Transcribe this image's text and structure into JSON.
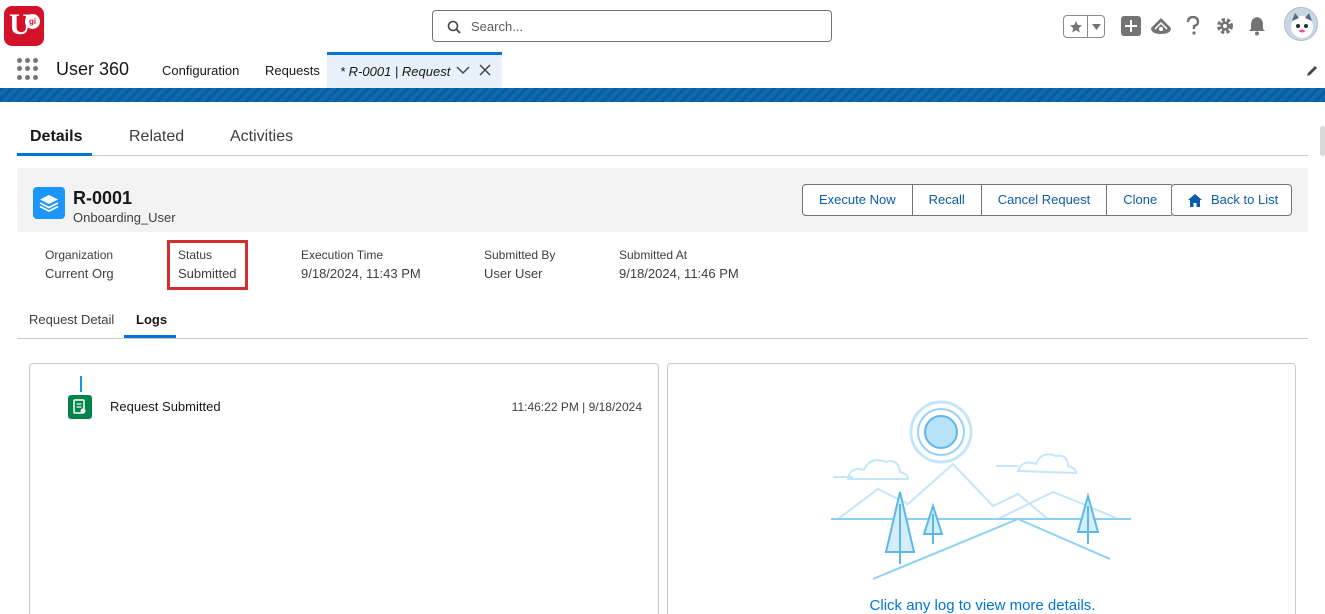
{
  "header": {
    "logo_text": "U",
    "logo_badge": "gi",
    "search_placeholder": "Search..."
  },
  "nav": {
    "app_name": "User 360",
    "items": [
      "Configuration",
      "Requests"
    ],
    "active_tab": "* R-0001 | Request"
  },
  "tabs": [
    "Details",
    "Related",
    "Activities"
  ],
  "record": {
    "id": "R-0001",
    "subtitle": "Onboarding_User",
    "actions": [
      "Execute Now",
      "Recall",
      "Cancel Request",
      "Clone"
    ],
    "back_label": "Back to List"
  },
  "fields": [
    {
      "label": "Organization",
      "value": "Current Org"
    },
    {
      "label": "Status",
      "value": "Submitted"
    },
    {
      "label": "Execution Time",
      "value": "9/18/2024, 11:43 PM"
    },
    {
      "label": "Submitted By",
      "value": "User User"
    },
    {
      "label": "Submitted At",
      "value": "9/18/2024, 11:46 PM"
    }
  ],
  "subtabs": [
    "Request Detail",
    "Logs"
  ],
  "logs": [
    {
      "text": "Request Submitted",
      "time": "11:46:22 PM | 9/18/2024"
    }
  ],
  "empty_message": "Click any log to view more details.",
  "colors": {
    "brand_red": "#d3122a",
    "accent_blue": "#0176d3",
    "highlight_red": "#d32f2f",
    "log_green": "#04844b"
  }
}
